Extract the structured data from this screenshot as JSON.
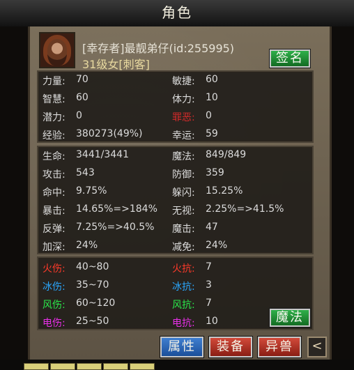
{
  "title": "角色",
  "character": {
    "name": "[幸存者]最靓弟仔(id:255995)",
    "level": "31级女[刺客]"
  },
  "buttons": {
    "sign": "签名",
    "magic": "魔法",
    "attributes": "属性",
    "equipment": "装备",
    "beast": "异兽",
    "back": "<"
  },
  "colors": {
    "fire": "#ff3a2a",
    "ice": "#2aa8ff",
    "wind": "#2ae84a",
    "electric": "#e830e8",
    "crime": "#d22a2a",
    "stat": "#dcdcdc"
  },
  "basic": [
    {
      "label": "力量:",
      "value": "70"
    },
    {
      "label": "敏捷:",
      "value": "60"
    },
    {
      "label": "智慧:",
      "value": "60"
    },
    {
      "label": "体力:",
      "value": "10"
    },
    {
      "label": "潜力:",
      "value": "0"
    },
    {
      "label": "罪恶:",
      "value": "0"
    },
    {
      "label": "经验:",
      "value": "380273(49%)"
    },
    {
      "label": "幸运:",
      "value": "59"
    }
  ],
  "combat": [
    {
      "label": "生命:",
      "value": "3441/3441"
    },
    {
      "label": "魔法:",
      "value": "849/849"
    },
    {
      "label": "攻击:",
      "value": "543"
    },
    {
      "label": "防御:",
      "value": "359"
    },
    {
      "label": "命中:",
      "value": "9.75%"
    },
    {
      "label": "躲闪:",
      "value": "15.25%"
    },
    {
      "label": "暴击:",
      "value": "14.65%=>184%"
    },
    {
      "label": "无视:",
      "value": "2.25%=>41.5%"
    },
    {
      "label": "反弹:",
      "value": "7.25%=>40.5%"
    },
    {
      "label": "魔击:",
      "value": "47"
    },
    {
      "label": "加深:",
      "value": "24%"
    },
    {
      "label": "减免:",
      "value": "24%"
    }
  ],
  "elements": [
    {
      "label": "火伤:",
      "value": "40~80"
    },
    {
      "label": "火抗:",
      "value": "7"
    },
    {
      "label": "冰伤:",
      "value": "35~70"
    },
    {
      "label": "冰抗:",
      "value": "3"
    },
    {
      "label": "风伤:",
      "value": "60~120"
    },
    {
      "label": "风抗:",
      "value": "7"
    },
    {
      "label": "电伤:",
      "value": "25~50"
    },
    {
      "label": "电抗:",
      "value": "10"
    }
  ]
}
